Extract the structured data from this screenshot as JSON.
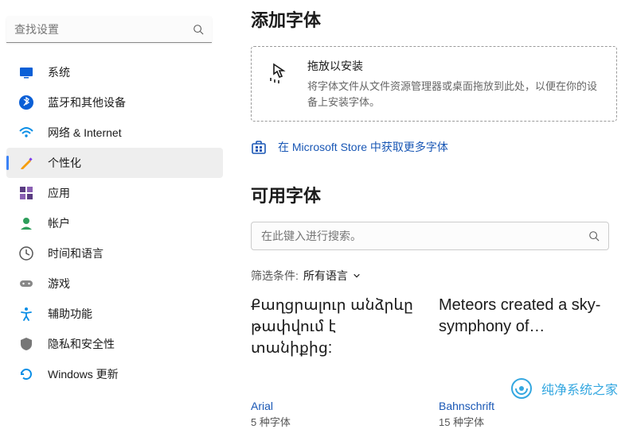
{
  "sidebar": {
    "search_placeholder": "查找设置",
    "items": [
      {
        "label": "系统",
        "icon": "system-icon"
      },
      {
        "label": "蓝牙和其他设备",
        "icon": "bluetooth-icon"
      },
      {
        "label": "网络 & Internet",
        "icon": "network-icon"
      },
      {
        "label": "个性化",
        "icon": "personalization-icon"
      },
      {
        "label": "应用",
        "icon": "apps-icon"
      },
      {
        "label": "帐户",
        "icon": "accounts-icon"
      },
      {
        "label": "时间和语言",
        "icon": "time-language-icon"
      },
      {
        "label": "游戏",
        "icon": "gaming-icon"
      },
      {
        "label": "辅助功能",
        "icon": "accessibility-icon"
      },
      {
        "label": "隐私和安全性",
        "icon": "privacy-icon"
      },
      {
        "label": "Windows 更新",
        "icon": "update-icon"
      }
    ]
  },
  "main": {
    "add_fonts_title": "添加字体",
    "drop_title": "拖放以安装",
    "drop_sub": "将字体文件从文件资源管理器或桌面拖放到此处，以便在你的设备上安装字体。",
    "store_link": "在 Microsoft Store 中获取更多字体",
    "available_title": "可用字体",
    "font_search_placeholder": "在此键入进行搜索。",
    "filter_label": "筛选条件:",
    "filter_value": "所有语言",
    "cards": [
      {
        "preview": "Քաղցրալուր անձրևը թափվում է տանիքից:",
        "name": "Arial",
        "count": "5 种字体"
      },
      {
        "preview": "Meteors created a sky-symphony of…",
        "name": "Bahnschrift",
        "count": "15 种字体"
      }
    ]
  },
  "watermark": {
    "text": "纯净系统之家"
  }
}
